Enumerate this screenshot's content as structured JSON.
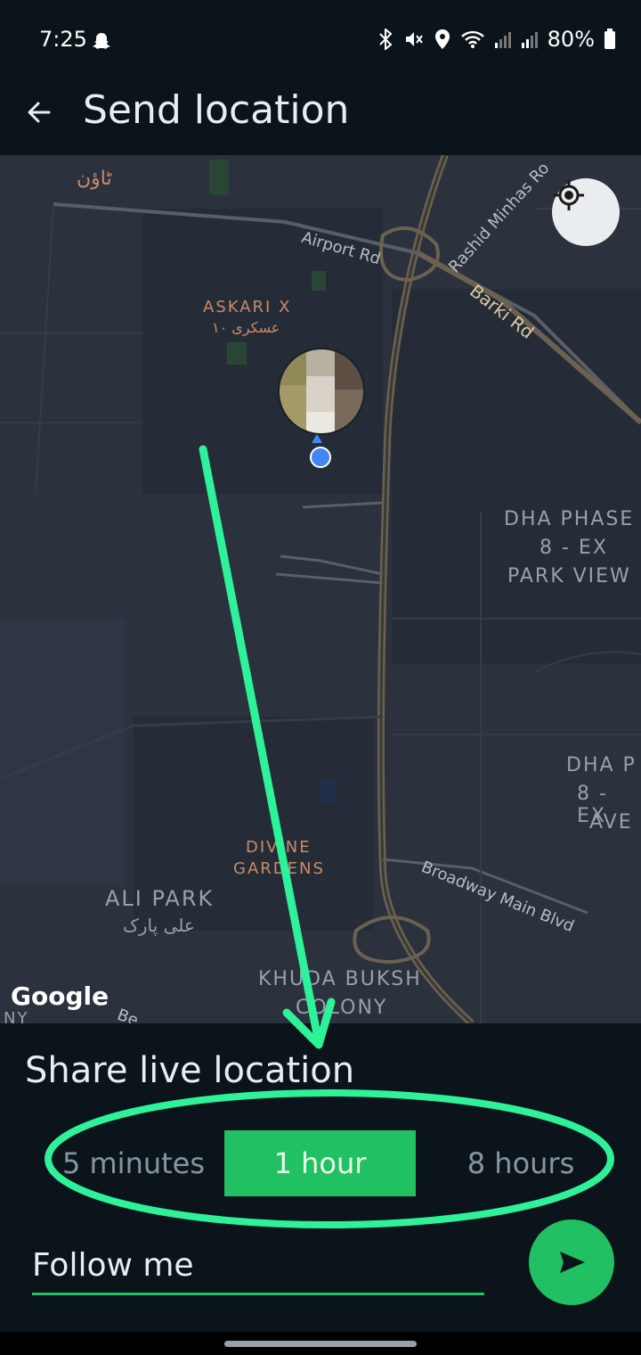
{
  "status_bar": {
    "time": "7:25",
    "battery": "80%"
  },
  "app_bar": {
    "title": "Send location"
  },
  "map": {
    "labels": {
      "askari_x": "ASKARI X",
      "askari_x_urdu": "عسکری ١٠",
      "town_urdu": "ٹاؤن",
      "airport_rd": "Airport Rd",
      "rashid_minhas": "Rashid Minhas Ro",
      "barki_rd": "Barki Rd",
      "dha_phase_8_ex_park_view_1": "DHA PHASE",
      "dha_phase_8_ex_park_view_2": "8 - EX",
      "dha_phase_8_ex_park_view_3": "PARK VIEW",
      "dha_p_1": "DHA P",
      "dha_p_2": "8 - EX",
      "dha_p_3": "AVE",
      "divine_1": "DIVINE",
      "divine_2": "GARDENS",
      "ali_park": "ALI PARK",
      "ali_park_urdu": "علی پارک",
      "broadway": "Broadway Main Blvd",
      "khuda_1": "KHUDA BUKSH",
      "khuda_2": "COLONY",
      "ny": "NY",
      "be": "Be"
    },
    "attribution": "Google"
  },
  "sheet": {
    "title": "Share live location",
    "options": [
      "5 minutes",
      "1 hour",
      "8 hours"
    ],
    "selected": "1 hour",
    "message": "Follow me"
  },
  "colors": {
    "accent": "#21c063",
    "annotation": "#2ef29a",
    "background": "#0b141a"
  },
  "icons": [
    "back-arrow-icon",
    "my-location-icon",
    "send-icon",
    "snapchat-icon",
    "bluetooth-icon",
    "mute-icon",
    "location-pin-icon",
    "wifi-icon",
    "signal-icon",
    "battery-icon"
  ]
}
